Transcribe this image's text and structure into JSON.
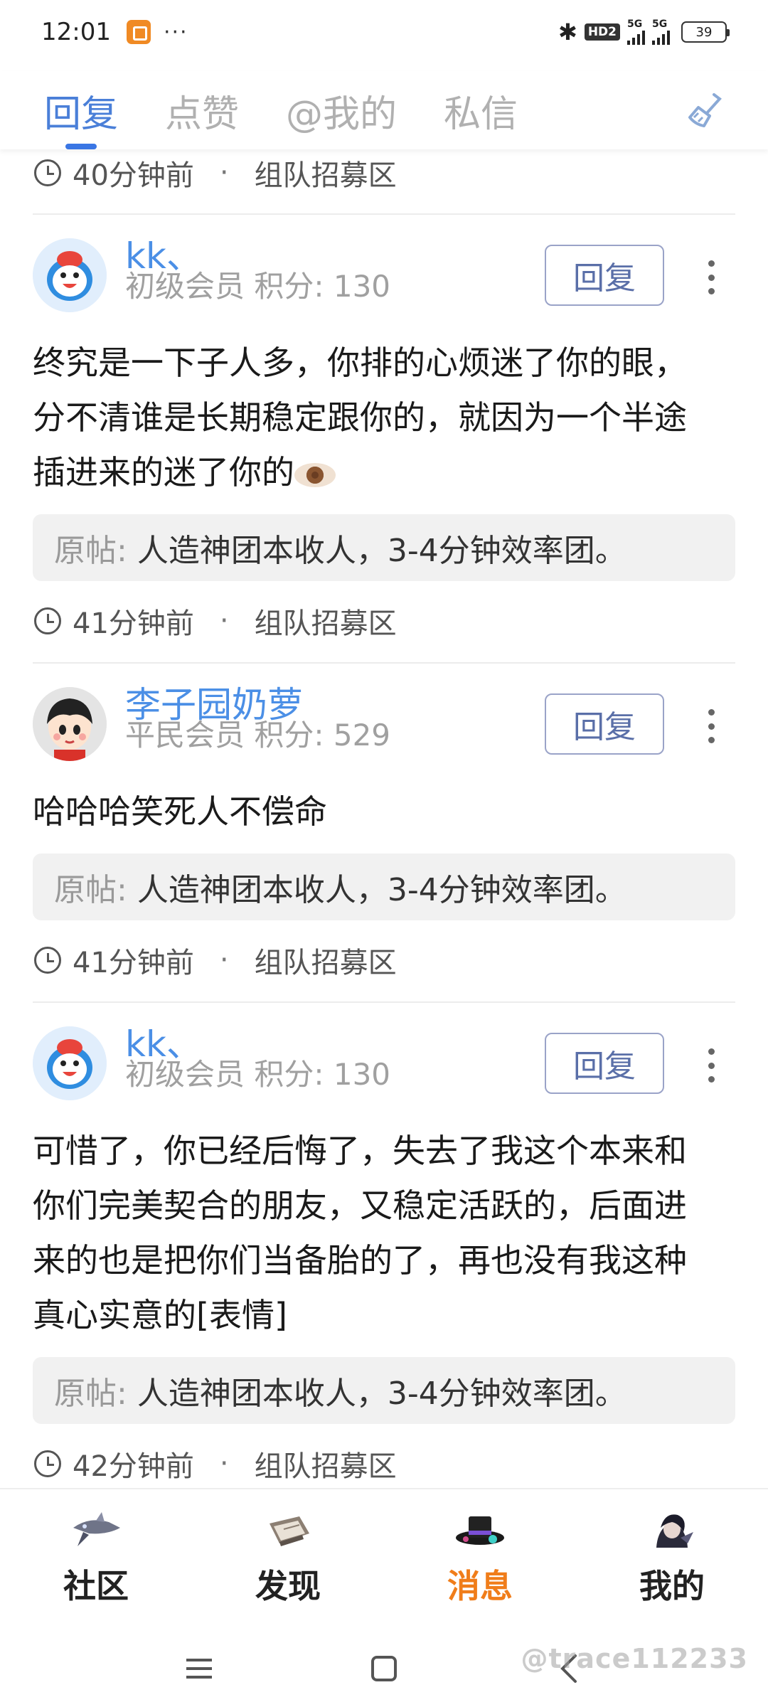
{
  "status_bar": {
    "time": "12:01",
    "dots": "···",
    "hd": "HD2",
    "net1": "5G",
    "net2": "5G",
    "battery": "39"
  },
  "tabs": [
    {
      "label": "回复",
      "active": true
    },
    {
      "label": "点赞",
      "active": false
    },
    {
      "label": "@我的",
      "active": false
    },
    {
      "label": "私信",
      "active": false
    }
  ],
  "feed": {
    "top_meta": {
      "time": "40分钟前",
      "sep": "·",
      "board": "组队招募区"
    },
    "posts": [
      {
        "username": "kk、",
        "level": "初级会员 积分: 130",
        "reply_label": "回复",
        "body": "终究是一下子人多，你排的心烦迷了你的眼，分不清谁是长期稳定跟你的，就因为一个半途插进来的迷了你的",
        "orig_label": "原帖:",
        "orig_text": "人造神团本收人，3-4分钟效率团。",
        "time": "41分钟前",
        "sep": "·",
        "board": "组队招募区"
      },
      {
        "username": "李子园奶萝",
        "level": "平民会员 积分: 529",
        "reply_label": "回复",
        "body": "哈哈哈笑死人不偿命",
        "orig_label": "原帖:",
        "orig_text": "人造神团本收人，3-4分钟效率团。",
        "time": "41分钟前",
        "sep": "·",
        "board": "组队招募区"
      },
      {
        "username": "kk、",
        "level": "初级会员 积分: 130",
        "reply_label": "回复",
        "body": "可惜了，你已经后悔了，失去了我这个本来和你们完美契合的朋友，又稳定活跃的，后面进来的也是把你们当备胎的了，再也没有我这种真心实意的[表情]",
        "orig_label": "原帖:",
        "orig_text": "人造神团本收人，3-4分钟效率团。",
        "time": "42分钟前",
        "sep": "·",
        "board": "组队招募区"
      }
    ]
  },
  "bottom_nav": [
    {
      "label": "社区",
      "icon": "community-icon",
      "active": false
    },
    {
      "label": "发现",
      "icon": "discover-icon",
      "active": false
    },
    {
      "label": "消息",
      "icon": "messages-icon",
      "active": true
    },
    {
      "label": "我的",
      "icon": "profile-icon",
      "active": false
    }
  ],
  "watermark": "@trace112233",
  "colors": {
    "accent_blue": "#4a7fd8",
    "username_blue": "#4b8fe6",
    "active_orange": "#f07d1a"
  }
}
